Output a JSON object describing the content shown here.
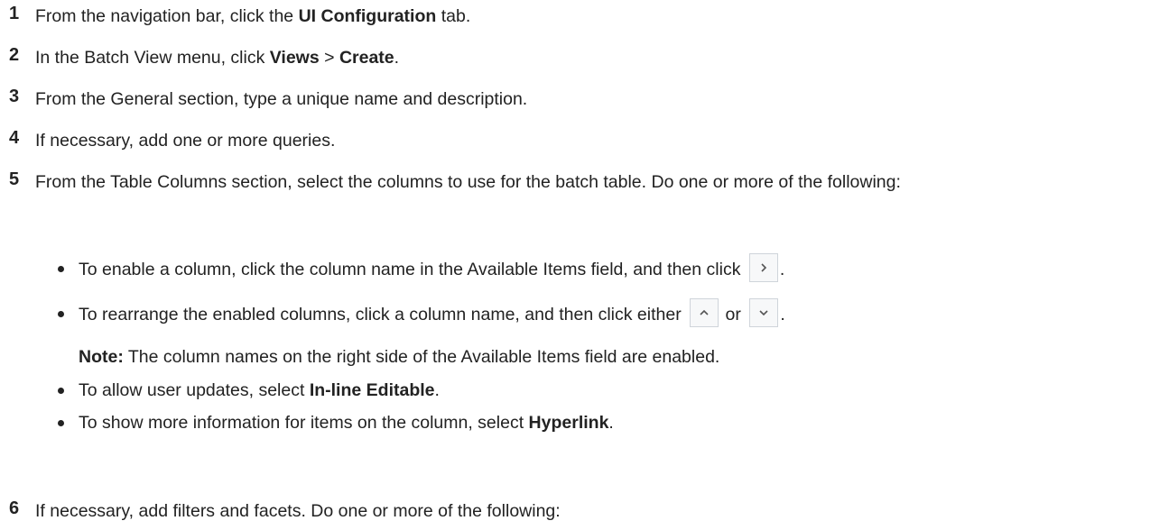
{
  "steps": [
    {
      "number": "1",
      "parts": {
        "a": "From the navigation bar, click the ",
        "b": "UI Configuration",
        "c": " tab."
      }
    },
    {
      "number": "2",
      "parts": {
        "a": "In the Batch View menu, click ",
        "b": "Views",
        "c": " > ",
        "d": "Create",
        "e": "."
      }
    },
    {
      "number": "3",
      "text": "From the General section, type a unique name and description."
    },
    {
      "number": "4",
      "text": "If necessary, add one or more queries."
    },
    {
      "number": "5",
      "text": "From the Table Columns section, select the columns to use for the batch table. Do one or more of the following:",
      "bullets": [
        {
          "a": "To enable a column, click the column name in the Available Items field, and then click ",
          "icon": "chevron-right-icon",
          "c": "."
        },
        {
          "a": "To rearrange the enabled columns, click a column name, and then click either ",
          "icon1": "chevron-up-icon",
          "mid": " or ",
          "icon2": "chevron-down-icon",
          "c": "."
        },
        {
          "a": "To allow user updates, select ",
          "b": "In-line Editable",
          "c": "."
        },
        {
          "a": "To show more information for items on the column, select ",
          "b": "Hyperlink",
          "c": "."
        }
      ],
      "note": {
        "label": "Note:",
        "text": " The column names on the right side of the Available Items field are enabled."
      }
    },
    {
      "number": "6",
      "text": "If necessary, add filters and facets. Do one or more of the following:"
    }
  ],
  "colors": {
    "text": "#222222",
    "button_border": "#cfd4da",
    "button_bg": "#f7f8f9",
    "icon": "#555555"
  }
}
